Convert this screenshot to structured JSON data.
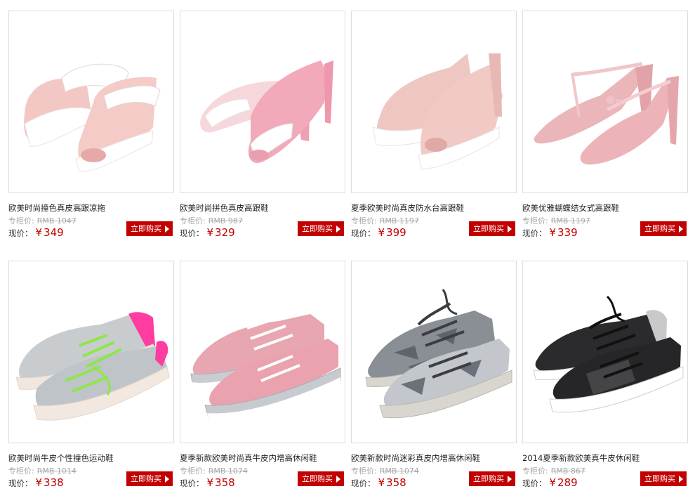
{
  "products": [
    {
      "title": "欧美时尚撞色真皮高跟凉拖",
      "orig_label": "专柜价:",
      "orig_price": "RMB 1047",
      "now_label": "现价：",
      "currency": "¥",
      "price": "349",
      "buy_label": "立即购买",
      "icon": "pink-peep-toe-mule-image",
      "color": "#f2c6c2",
      "accent": "#ffffff"
    },
    {
      "title": "欧美时尚拼色真皮高跟鞋",
      "orig_label": "专柜价:",
      "orig_price": "RMB 987",
      "now_label": "现价：",
      "currency": "¥",
      "price": "329",
      "buy_label": "立即购买",
      "icon": "pink-peep-toe-pump-image",
      "color": "#f0a9b8",
      "accent": "#ffffff"
    },
    {
      "title": "夏季欧美时尚真皮防水台高跟鞋",
      "orig_label": "专柜价:",
      "orig_price": "RMB 1197",
      "now_label": "现价：",
      "currency": "¥",
      "price": "399",
      "buy_label": "立即购买",
      "icon": "pink-platform-bootie-image",
      "color": "#eec4be",
      "accent": "#ffffff"
    },
    {
      "title": "欧美优雅蝴蝶结女式高跟鞋",
      "orig_label": "专柜价:",
      "orig_price": "RMB 1197",
      "now_label": "现价：",
      "currency": "¥",
      "price": "339",
      "buy_label": "立即购买",
      "icon": "pink-bow-heel-image",
      "color": "#eab3b7",
      "accent": "#f5d3d5"
    },
    {
      "title": "欧美时尚牛皮个性撞色运动鞋",
      "orig_label": "专柜价:",
      "orig_price": "RMB 1014",
      "now_label": "现价：",
      "currency": "¥",
      "price": "338",
      "buy_label": "立即购买",
      "icon": "silver-neon-sneaker-image",
      "color": "#c9cccf",
      "accent": "#ff3ca0"
    },
    {
      "title": "夏季新款欧美时尚真牛皮内增高休闲鞋",
      "orig_label": "专柜价:",
      "orig_price": "RMB 1074",
      "now_label": "现价：",
      "currency": "¥",
      "price": "358",
      "buy_label": "立即购买",
      "icon": "pink-silver-sneaker-image",
      "color": "#e6a3ad",
      "accent": "#c8ccd0"
    },
    {
      "title": "欧美新款时尚迷彩真皮内增高休闲鞋",
      "orig_label": "专柜价:",
      "orig_price": "RMB 1074",
      "now_label": "现价：",
      "currency": "¥",
      "price": "358",
      "buy_label": "立即购买",
      "icon": "camo-silver-sneaker-image",
      "color": "#8a8f96",
      "accent": "#c7cbd0"
    },
    {
      "title": "2014夏季新款欧美真牛皮休闲鞋",
      "orig_label": "专柜价:",
      "orig_price": "RMB 867",
      "now_label": "现价：",
      "currency": "¥",
      "price": "289",
      "buy_label": "立即购买",
      "icon": "black-sneaker-image",
      "color": "#2a2a2c",
      "accent": "#c9c9c9"
    }
  ]
}
